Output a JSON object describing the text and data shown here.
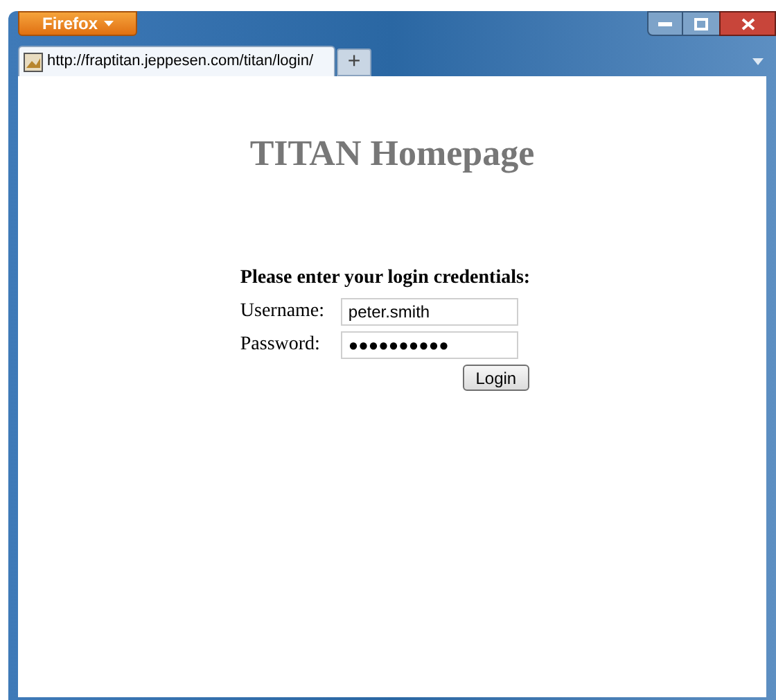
{
  "browser": {
    "menu_button": "Firefox",
    "tab": {
      "title": "http://fraptitan.jeppesen.com/titan/login/"
    },
    "new_tab": "+"
  },
  "page": {
    "heading": "TITAN Homepage",
    "prompt": "Please enter your login credentials:",
    "fields": [
      {
        "label": "Username:",
        "value": "peter.smith"
      },
      {
        "label": "Password:",
        "value": "●●●●●●●●●●"
      }
    ],
    "button": "Login"
  }
}
